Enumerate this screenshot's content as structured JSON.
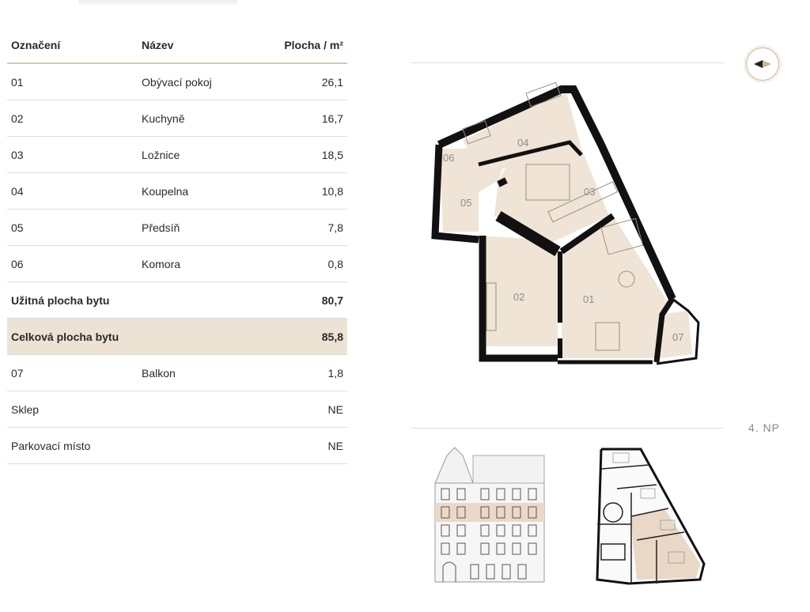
{
  "table": {
    "headers": {
      "code": "Označení",
      "name": "Název",
      "area": "Plocha / m²"
    },
    "rows": [
      {
        "code": "01",
        "name": "Obývací pokoj",
        "area": "26,1"
      },
      {
        "code": "02",
        "name": "Kuchyně",
        "area": "16,7"
      },
      {
        "code": "03",
        "name": "Ložnice",
        "area": "18,5"
      },
      {
        "code": "04",
        "name": "Koupelna",
        "area": "10,8"
      },
      {
        "code": "05",
        "name": "Předsíň",
        "area": "7,8"
      },
      {
        "code": "06",
        "name": "Komora",
        "area": "0,8"
      }
    ],
    "usable": {
      "label": "Užitná plocha bytu",
      "area": "80,7"
    },
    "total": {
      "label": "Celková plocha bytu",
      "area": "85,8"
    },
    "extra": [
      {
        "code": "07",
        "name": "Balkon",
        "area": "1,8"
      },
      {
        "code": "Sklep",
        "name": "",
        "area": "NE"
      },
      {
        "code": "Parkovací místo",
        "name": "",
        "area": "NE"
      }
    ]
  },
  "plan": {
    "rooms": [
      "01",
      "02",
      "03",
      "04",
      "05",
      "06",
      "07"
    ]
  },
  "floor_label": "4. NP",
  "colors": {
    "accent": "#d8c9b3",
    "highlight": "#ece3d5",
    "room_fill": "#efe4d6",
    "wall": "#111111"
  }
}
